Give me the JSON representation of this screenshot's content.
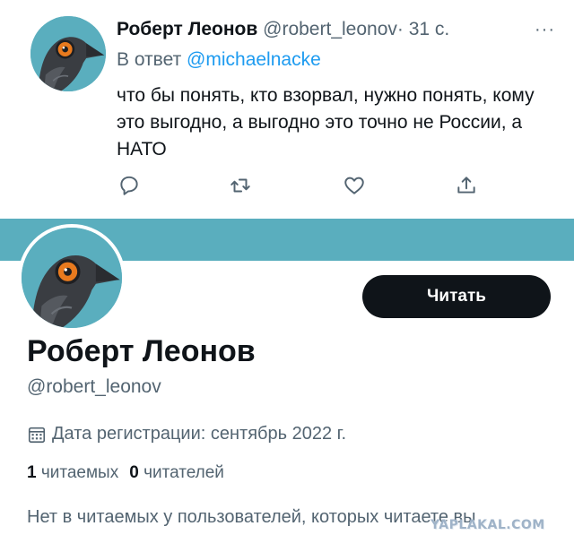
{
  "tweet": {
    "author_name": "Роберт Леонов",
    "author_handle": "@robert_leonov",
    "time": "· 31 с.",
    "more_icon": "more-dots-icon",
    "reply_prefix": "В ответ",
    "reply_handle": "@michaelnacke",
    "text": "что бы понять, кто взорвал, нужно понять, кому это выгодно, а выгодно это точно не России, а НАТО",
    "actions": [
      "reply-icon",
      "retweet-icon",
      "like-icon",
      "share-icon"
    ]
  },
  "profile": {
    "banner_color": "#5aaebe",
    "follow_label": "Читать",
    "name": "Роберт Леонов",
    "handle": "@robert_leonov",
    "joined": "Дата регистрации: сентябрь 2022 г.",
    "following_count": "1",
    "following_label": "читаемых",
    "followers_count": "0",
    "followers_label": "читателей",
    "empty_note": "Нет в читаемых у пользователей, которых читаете вы"
  },
  "watermark": "YAPLAKAL.COM",
  "colors": {
    "accent": "#1d9bf0",
    "text": "#0f1419",
    "muted": "#536471",
    "button": "#0f1419"
  }
}
